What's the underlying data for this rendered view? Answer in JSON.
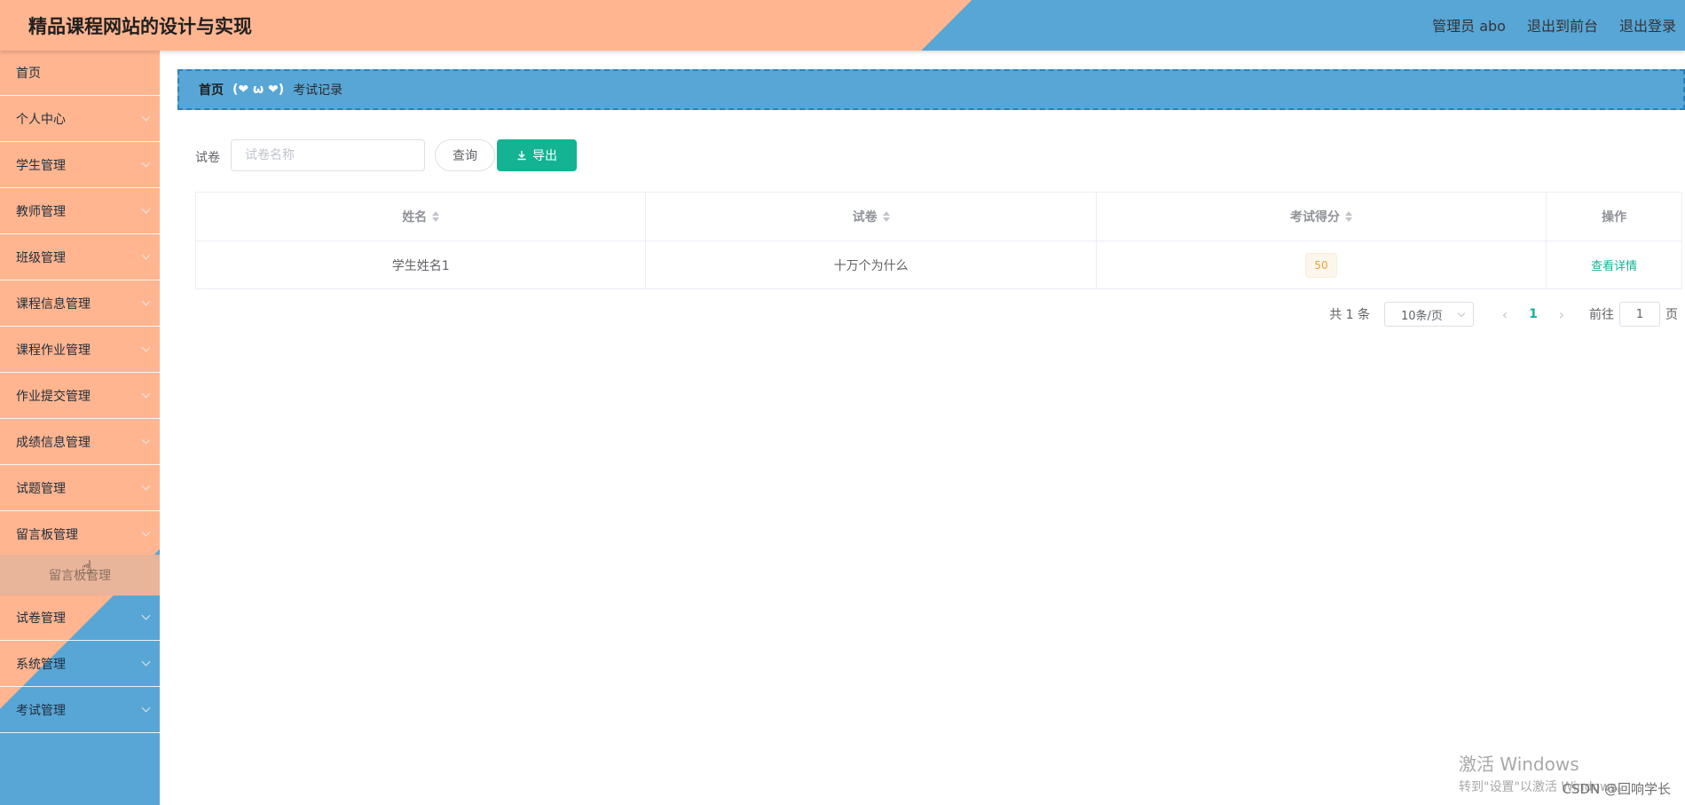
{
  "header": {
    "title": "精品课程网站的设计与实现",
    "user_label": "管理员 abo",
    "back_label": "退出到前台",
    "logout_label": "退出登录"
  },
  "sidebar": {
    "items": [
      {
        "label": "首页",
        "has_arrow": false
      },
      {
        "label": "个人中心",
        "has_arrow": true
      },
      {
        "label": "学生管理",
        "has_arrow": true
      },
      {
        "label": "教师管理",
        "has_arrow": true
      },
      {
        "label": "班级管理",
        "has_arrow": true
      },
      {
        "label": "课程信息管理",
        "has_arrow": true
      },
      {
        "label": "课程作业管理",
        "has_arrow": true
      },
      {
        "label": "作业提交管理",
        "has_arrow": true
      },
      {
        "label": "成绩信息管理",
        "has_arrow": true
      },
      {
        "label": "试题管理",
        "has_arrow": true
      },
      {
        "label": "留言板管理",
        "has_arrow": true
      },
      {
        "label": "试卷管理",
        "has_arrow": true
      },
      {
        "label": "系统管理",
        "has_arrow": true
      },
      {
        "label": "考试管理",
        "has_arrow": true
      }
    ],
    "submenu_label": "留言板管理"
  },
  "breadcrumb": {
    "home": "首页",
    "separator": "(❤ ω ❤)",
    "current": "考试记录"
  },
  "search": {
    "label": "试卷",
    "placeholder": "试卷名称",
    "query_label": "查询",
    "export_label": "导出"
  },
  "table": {
    "columns": [
      "姓名",
      "试卷",
      "考试得分",
      "操作"
    ],
    "rows": [
      {
        "name": "学生姓名1",
        "paper": "十万个为什么",
        "score": "50",
        "action": "查看详情"
      }
    ]
  },
  "pagination": {
    "total": "共 1 条",
    "page_size": "10条/页",
    "current_page": "1",
    "goto_label": "前往",
    "goto_value": "1",
    "page_unit": "页"
  },
  "watermark": {
    "windows_line1": "激活 Windows",
    "windows_line2": "转到\"设置\"以激活 Windows。",
    "csdn": "CSDN @回响学长"
  },
  "colors": {
    "peach": "#ffb58f",
    "blue": "#57a6d6",
    "accent_green": "#13b394",
    "score_orange": "#e6a23c"
  }
}
